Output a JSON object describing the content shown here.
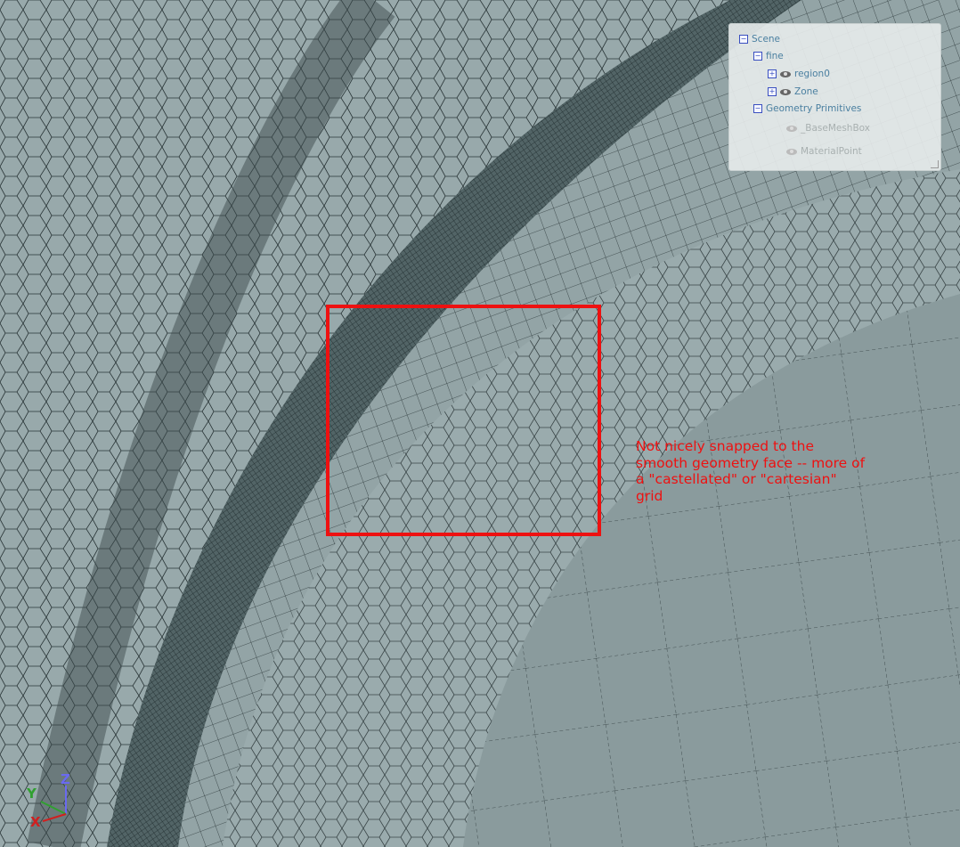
{
  "scene_tree": {
    "items": [
      {
        "label": "Scene",
        "toggle": "−"
      },
      {
        "label": "fine",
        "toggle": "−"
      },
      {
        "label": "region0",
        "toggle": "+"
      },
      {
        "label": "Zone",
        "toggle": "+"
      },
      {
        "label": "Geometry Primitives",
        "toggle": "−"
      },
      {
        "label": "_BaseMeshBox"
      },
      {
        "label": "MaterialPoint"
      }
    ]
  },
  "annotation": {
    "text": "Not nicely snapped to the smooth geometry face -- more of a \"castellated\" or \"cartesian\" grid",
    "color": "#ee1111"
  },
  "axes": {
    "x": "X",
    "y": "Y",
    "z": "Z"
  }
}
